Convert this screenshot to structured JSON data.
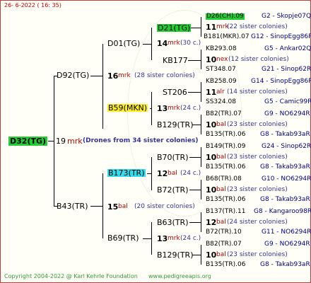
{
  "date_line": "26-  6-2022 (  16:  35)",
  "root": "D32(TG)",
  "root_count": "19",
  "root_mark": "mrk",
  "root_note": "(Drones from 34 sister colonies)",
  "gen1": [
    {
      "name": "D92(TG)",
      "count": "16",
      "mark": "mrk",
      "note": "(28 sister colonies)"
    },
    {
      "name": "B43(TR)",
      "count": "15",
      "mark": "bal",
      "note": "(20 sister colonies)"
    }
  ],
  "gen2": [
    {
      "name": "D01(TG)",
      "count": "14",
      "mark": "mrk",
      "note": "(30 c.)"
    },
    {
      "name": "B59(MKN)",
      "count": "13",
      "mark": "mrk",
      "note": "(24 c.)"
    },
    {
      "name": "B173(TR)",
      "count": "12",
      "mark": "bal",
      "note": "(24 c.)"
    },
    {
      "name": "B69(TR)",
      "count": "13",
      "mark": "mrk",
      "note": "(24 c.)"
    }
  ],
  "gen3": [
    "D21(TG)",
    "KB177",
    "ST206",
    "B129(TR)",
    "B70(TR)",
    "B72(TR)",
    "B63(TR)",
    "B129(TR)"
  ],
  "gen4": [
    {
      "top": "D26(CH).09",
      "tcode": "G2 - Skopje07Q",
      "count": "11",
      "mark": "mrk",
      "note": "(22 sister colonies)",
      "bot": "B181(MKR).07",
      "bcode": "G12 - SinopEgg86R"
    },
    {
      "top": "KB293.08",
      "tcode": "G5 - Ankar02Q",
      "count": "10",
      "mark": "nex",
      "note": "(12 sister colonies)",
      "bot": "ST348.07",
      "bcode": "G21 - Sinop62R"
    },
    {
      "top": "KB258.09",
      "tcode": "G14 - SinopEgg86R",
      "count": "11",
      "mark": "alr",
      "note": "(14 sister colonies)",
      "bot": "SS324.08",
      "bcode": "G5 - Camic99R"
    },
    {
      "top": "B82(TR).07",
      "tcode": "G9 - NO6294R",
      "count": "10",
      "mark": "bal",
      "note": "(23 sister colonies)",
      "bot": "B135(TR).06",
      "bcode": "G8 - Takab93aR"
    },
    {
      "top": "B149(TR).09",
      "tcode": "G24 - Sinop62R",
      "count": "10",
      "mark": "bal",
      "note": "(23 sister colonies)",
      "bot": "B135(TR).06",
      "bcode": "G8 - Takab93aR"
    },
    {
      "top": "B68(TR).08",
      "tcode": "G10 - NO6294R",
      "count": "10",
      "mark": "bal",
      "note": "(23 sister colonies)",
      "bot": "B135(TR).06",
      "bcode": "G8 - Takab93aR"
    },
    {
      "top": "B137(TR).11",
      "tcode": "G8 - Kangaroo98R",
      "count": "12",
      "mark": "bal",
      "note": "(24 sister colonies)",
      "bot": "B72(TR).10",
      "bcode": "G11 - NO6294R"
    },
    {
      "top": "B82(TR).07",
      "tcode": "G9 - NO6294R",
      "count": "10",
      "mark": "bal",
      "note": "(23 sister colonies)",
      "bot": "B135(TR).06",
      "bcode": "G8 - Takab93aR"
    }
  ],
  "footer": {
    "copyright": "Copyright 2004-2022 @ Karl Kehrle Foundation",
    "site": "www.pedigreeapis.org"
  },
  "colors": {
    "green": "#22cc33",
    "yellow": "#ffee22",
    "cyan": "#33ddee",
    "mark": "#bb0000",
    "code": "#000088"
  }
}
